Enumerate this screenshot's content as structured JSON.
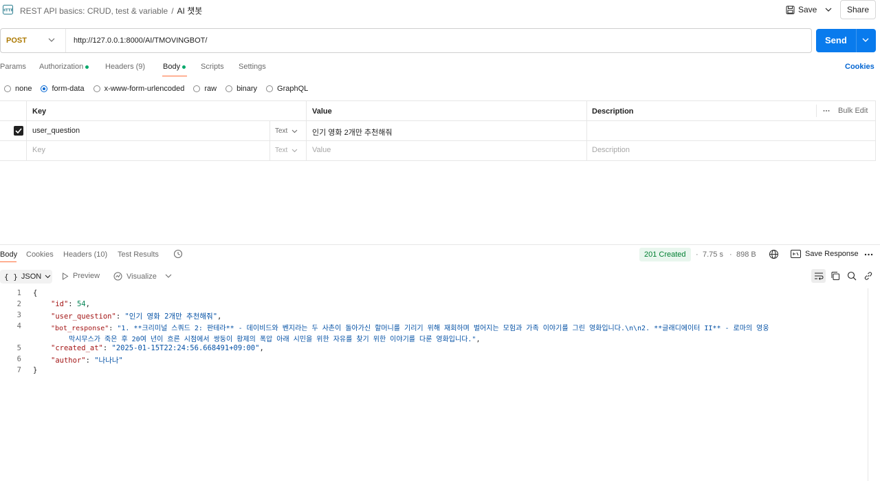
{
  "header": {
    "collection": "REST API basics: CRUD, test & variable",
    "separator": "/",
    "request_name": "AI 챗봇",
    "save_label": "Save",
    "share_label": "Share"
  },
  "request": {
    "method": "POST",
    "url": "http://127.0.0.1:8000/AI/TMOVINGBOT/",
    "send_label": "Send"
  },
  "request_tabs": {
    "params": "Params",
    "authorization": "Authorization",
    "headers": "Headers (9)",
    "body": "Body",
    "scripts": "Scripts",
    "settings": "Settings",
    "cookies": "Cookies"
  },
  "body_types": {
    "none": "none",
    "form_data": "form-data",
    "urlencoded": "x-www-form-urlencoded",
    "raw": "raw",
    "binary": "binary",
    "graphql": "GraphQL",
    "selected": "form-data"
  },
  "params_table": {
    "headers": {
      "key": "Key",
      "value": "Value",
      "description": "Description",
      "bulk_edit": "Bulk Edit"
    },
    "rows": [
      {
        "checked": true,
        "key": "user_question",
        "type": "Text",
        "value": "인기 영화 2개만 추천해줘",
        "description": ""
      }
    ],
    "placeholder": {
      "key": "Key",
      "type": "Text",
      "value": "Value",
      "description": "Description"
    }
  },
  "response": {
    "tabs": {
      "body": "Body",
      "cookies": "Cookies",
      "headers": "Headers (10)",
      "test_results": "Test Results"
    },
    "status": "201 Created",
    "time": "7.75 s",
    "size": "898 B",
    "save_response": "Save Response",
    "format": "JSON",
    "preview": "Preview",
    "visualize": "Visualize",
    "json_lines": {
      "l1": "{",
      "id_key": "\"id\"",
      "id_val": "54",
      "uq_key": "\"user_question\"",
      "uq_val": "\"인기 영화 2개만 추천해줘\"",
      "br_key": "\"bot_response\"",
      "br_val_1": "\"1. **크리미널 스쿼드 2: 판테라** - 데이비드와 벤지라는 두 사촌이 돌아가신 할머니를 기리기 위해 재회하며 벌어지는 모험과 가족 이야기를 그린 영화입니다.\\n\\n2. **글래디에이터 II** - 로마의 영웅",
      "br_val_2": "막시무스가 죽은 후 20여 년이 흐른 시점에서 쌍둥이 황제의 폭압 아래 시민을 위한 자유를 찾기 위한 이야기를 다룬 영화입니다.\"",
      "ca_key": "\"created_at\"",
      "ca_val": "\"2025-01-15T22:24:56.668491+09:00\"",
      "au_key": "\"author\"",
      "au_val": "\"나나나\"",
      "l7": "}"
    },
    "line_numbers": [
      "1",
      "2",
      "3",
      "4",
      "5",
      "6",
      "7"
    ]
  },
  "colors": {
    "accent": "#097bed",
    "method": "#ad7a03",
    "status_ok": "#007f31",
    "tab_active": "#ff6c37"
  },
  "icons": [
    "http-icon",
    "save-icon",
    "chevron-down-icon",
    "history-icon",
    "globe-icon",
    "save-response-icon",
    "more-icon",
    "braces-icon",
    "play-icon",
    "visualize-icon",
    "wrap-icon",
    "copy-icon",
    "search-icon",
    "link-icon",
    "check-icon",
    "bulk-edit-more-icon"
  ]
}
